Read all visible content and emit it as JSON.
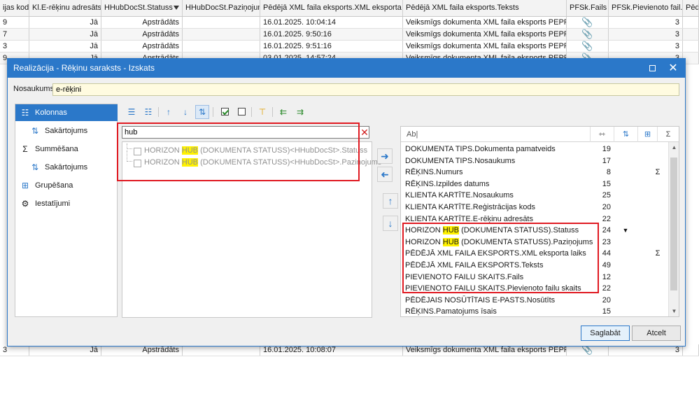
{
  "bg": {
    "headers": [
      "ijas kods",
      "Kl.E-rēķinu adresāts",
      "HHubDocSt.Statuss",
      "HHubDocSt.Paziņojums",
      "Pēdējā XML faila eksports.XML eksporta laiks",
      "Pēdējā XML faila eksports.Teksts",
      "PFSk.Fails",
      "PFSk.Pievienoto fail...",
      "Pēdē"
    ],
    "rows": [
      [
        "9",
        "Jā",
        "Apstrādāts",
        "",
        "16.01.2025. 10:04:14",
        "Veiksmīgs dokumenta XML faila eksports PEPPOL ...",
        "📎",
        "3"
      ],
      [
        "7",
        "Jā",
        "Apstrādāts",
        "",
        "16.01.2025. 9:50:16",
        "Veiksmīgs dokumenta XML faila eksports PEPPOL ...",
        "📎",
        "3"
      ],
      [
        "3",
        "Jā",
        "Apstrādāts",
        "",
        "16.01.2025. 9:51:16",
        "Veiksmīgs dokumenta XML faila eksports PEPPOL ...",
        "📎",
        "3"
      ],
      [
        "9",
        "Jā",
        "Apstrādāts",
        "",
        "03.01.2025. 14:57:24",
        "Veiksmīgs dokumenta XML faila eksports PEPPOL ...",
        "📎",
        "3"
      ]
    ],
    "bottom_row": [
      "3",
      "Jā",
      "Apstrādāts",
      "",
      "16.01.2025. 10:08:07",
      "Veiksmīgs dokumenta XML faila eksports PEPPOL ...",
      "📎",
      "3"
    ]
  },
  "dialog": {
    "title": "Realizācija - Rēķinu saraksts - Izskats",
    "name_label": "Nosaukums:",
    "name_value": "e-rēķini",
    "nav": {
      "columns": "Kolonnas",
      "sort1": "Sakārtojums",
      "sum": "Summēšana",
      "sort2": "Sakārtojums",
      "group": "Grupēšana",
      "settings": "Iestatījumi"
    },
    "search_value": "hub",
    "available": [
      {
        "pre": "HORIZON ",
        "hl": "HUB",
        "post": " (DOKUMENTA STATUSS)<HHubDocSt>.Statuss"
      },
      {
        "pre": "HORIZON ",
        "hl": "HUB",
        "post": " (DOKUMENTA STATUSS)<HHubDocSt>.Paziņojums"
      }
    ],
    "selected_header": {
      "name": "Ab|"
    },
    "selected": [
      {
        "pre": "DOKUMENTA TIPS.Dokumenta pamatveids",
        "hl": "",
        "post": "",
        "len": "19",
        "sort": "",
        "agg": ""
      },
      {
        "pre": "DOKUMENTA TIPS.Nosaukums",
        "hl": "",
        "post": "",
        "len": "17",
        "sort": "",
        "agg": ""
      },
      {
        "pre": "RĒĶINS.Numurs",
        "hl": "",
        "post": "",
        "len": "8",
        "sort": "",
        "agg": "Σ"
      },
      {
        "pre": "RĒĶINS.Izpildes datums",
        "hl": "",
        "post": "",
        "len": "15",
        "sort": "",
        "agg": ""
      },
      {
        "pre": "KLIENTA KARTĪTE.Nosaukums",
        "hl": "",
        "post": "",
        "len": "25",
        "sort": "",
        "agg": ""
      },
      {
        "pre": "KLIENTA KARTĪTE.Reģistrācijas kods",
        "hl": "",
        "post": "",
        "len": "20",
        "sort": "",
        "agg": ""
      },
      {
        "pre": "KLIENTA KARTĪTE.E-rēķinu adresāts",
        "hl": "",
        "post": "",
        "len": "22",
        "sort": "",
        "agg": ""
      },
      {
        "pre": "HORIZON ",
        "hl": "HUB",
        "post": " (DOKUMENTA STATUSS).Statuss",
        "len": "24",
        "sort": "▼",
        "agg": ""
      },
      {
        "pre": "HORIZON ",
        "hl": "HUB",
        "post": " (DOKUMENTA STATUSS).Paziņojums",
        "len": "23",
        "sort": "",
        "agg": ""
      },
      {
        "pre": "PĒDĒJĀ XML FAILA EKSPORTS.XML eksporta laiks",
        "hl": "",
        "post": "",
        "len": "44",
        "sort": "",
        "agg": "Σ"
      },
      {
        "pre": "PĒDĒJĀ XML FAILA EKSPORTS.Teksts",
        "hl": "",
        "post": "",
        "len": "49",
        "sort": "",
        "agg": ""
      },
      {
        "pre": "PIEVIENOTO FAILU SKAITS.Fails",
        "hl": "",
        "post": "",
        "len": "12",
        "sort": "",
        "agg": ""
      },
      {
        "pre": "PIEVIENOTO FAILU SKAITS.Pievienoto failu skaits",
        "hl": "",
        "post": "",
        "len": "22",
        "sort": "",
        "agg": ""
      },
      {
        "pre": "PĒDĒJAIS NOSŪTĪTAIS E-PASTS.Nosūtīts",
        "hl": "",
        "post": "",
        "len": "20",
        "sort": "",
        "agg": ""
      },
      {
        "pre": "RĒĶINS.Pamatojums īsais",
        "hl": "",
        "post": "",
        "len": "15",
        "sort": "",
        "agg": ""
      }
    ],
    "buttons": {
      "save": "Saglabāt",
      "cancel": "Atcelt"
    },
    "colors": {
      "accent": "#2b78c9",
      "highlight": "#fff200",
      "annotation": "#e01a22"
    }
  }
}
